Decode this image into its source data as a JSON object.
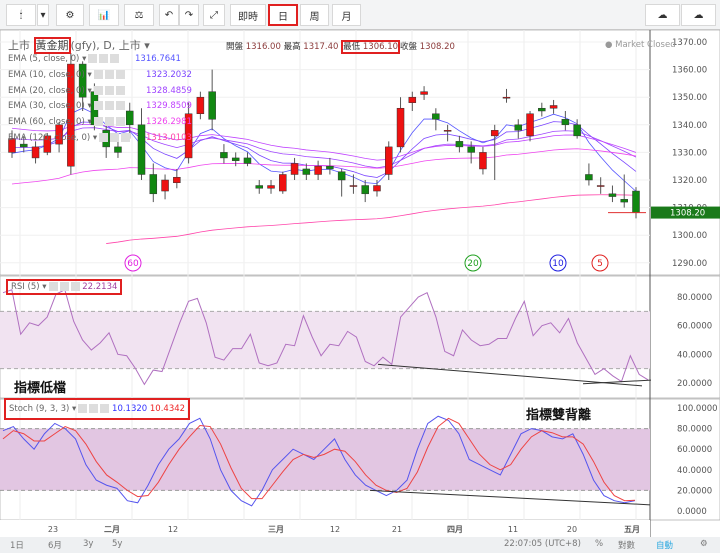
{
  "toolbar": {
    "buttons": [
      "即時",
      "日",
      "周",
      "月"
    ],
    "selected": "日"
  },
  "header": {
    "symbol_prefix": "上市",
    "symbol_name": "黃金期",
    "symbol_rest": "(gfy), D, 上市",
    "open_label": "開盤",
    "open": "1316.00",
    "high_label": "最高",
    "high": "1317.40",
    "low_label": "最低",
    "low": "1306.10",
    "close_label": "收盤",
    "close": "1308.20",
    "market_status": "Market Closed"
  },
  "ema": [
    {
      "label": "EMA (5, close, 0)",
      "value": "1316.7641",
      "color": "#5555ff"
    },
    {
      "label": "EMA (10, close, 0)",
      "value": "1323.2032",
      "color": "#7a44ff"
    },
    {
      "label": "EMA (20, close, 0)",
      "value": "1328.4859",
      "color": "#a044ff"
    },
    {
      "label": "EMA (30, close, 0)",
      "value": "1329.8509",
      "color": "#c044ff"
    },
    {
      "label": "EMA (60, close, 0)",
      "value": "1326.2981",
      "color": "#ee44ee"
    },
    {
      "label": "EMA (120, close, 0)",
      "value": "1313.0103",
      "color": "#ff44aa"
    }
  ],
  "markers": [
    {
      "label": "60",
      "color": "#e020e0"
    },
    {
      "label": "20",
      "color": "#20a020"
    },
    {
      "label": "10",
      "color": "#2020e0"
    },
    {
      "label": "5",
      "color": "#e02020"
    }
  ],
  "price_axis": {
    "ticks": [
      "1370.00",
      "1360.00",
      "1350.00",
      "1340.00",
      "1330.00",
      "1320.00",
      "1310.00",
      "1300.00",
      "1290.00"
    ],
    "last": "1308.20"
  },
  "rsi": {
    "label": "RSI (5)",
    "value": "22.2134",
    "ticks": [
      "80.0000",
      "60.0000",
      "40.0000",
      "20.0000"
    ],
    "annotation": "指標低檔"
  },
  "stoch": {
    "label": "Stoch (9, 3, 3)",
    "k": "10.1320",
    "d": "10.4342",
    "ticks": [
      "100.0000",
      "80.0000",
      "60.0000",
      "40.0000",
      "20.0000",
      "0.0000"
    ],
    "annotation": "指標雙背離"
  },
  "x_axis": [
    "23",
    "二月",
    "12",
    "三月",
    "12",
    "21",
    "四月",
    "11",
    "20",
    "五月"
  ],
  "bottom": {
    "ranges": [
      "1日",
      "6月",
      "3y",
      "5y"
    ],
    "time": "22:07:05 (UTC+8)",
    "percent": "%",
    "log": "對數",
    "auto": "自動"
  },
  "chart_data": {
    "type": "candlestick",
    "ohlc": [
      [
        1330,
        1338,
        1328,
        1335
      ],
      [
        1333,
        1336,
        1330,
        1332
      ],
      [
        1328,
        1334,
        1326,
        1332
      ],
      [
        1330,
        1337,
        1329,
        1336
      ],
      [
        1333,
        1341,
        1330,
        1340
      ],
      [
        1325,
        1366,
        1322,
        1362
      ],
      [
        1362,
        1363,
        1345,
        1350
      ],
      [
        1352,
        1355,
        1338,
        1340
      ],
      [
        1338,
        1342,
        1328,
        1332
      ],
      [
        1332,
        1335,
        1328,
        1330
      ],
      [
        1345,
        1348,
        1335,
        1340
      ],
      [
        1340,
        1346,
        1320,
        1322
      ],
      [
        1322,
        1326,
        1312,
        1315
      ],
      [
        1316,
        1322,
        1313,
        1320
      ],
      [
        1319,
        1324,
        1317,
        1321
      ],
      [
        1328,
        1348,
        1326,
        1344
      ],
      [
        1344,
        1352,
        1342,
        1350
      ],
      [
        1352,
        1360,
        1338,
        1342
      ],
      [
        1330,
        1333,
        1326,
        1328
      ],
      [
        1328,
        1330,
        1325,
        1327
      ],
      [
        1328,
        1330,
        1325,
        1326
      ],
      [
        1318,
        1320,
        1315,
        1317
      ],
      [
        1317,
        1320,
        1315,
        1318
      ],
      [
        1316,
        1323,
        1315,
        1322
      ],
      [
        1322,
        1328,
        1320,
        1326
      ],
      [
        1324,
        1326,
        1320,
        1322
      ],
      [
        1322,
        1327,
        1320,
        1325
      ],
      [
        1325,
        1328,
        1322,
        1324
      ],
      [
        1323,
        1324,
        1314,
        1320
      ],
      [
        1318,
        1322,
        1315,
        1318
      ],
      [
        1318,
        1320,
        1312,
        1315
      ],
      [
        1316,
        1320,
        1314,
        1318
      ],
      [
        1322,
        1334,
        1320,
        1332
      ],
      [
        1332,
        1350,
        1330,
        1346
      ],
      [
        1348,
        1352,
        1345,
        1350
      ],
      [
        1351,
        1354,
        1349,
        1352
      ],
      [
        1344,
        1346,
        1338,
        1342
      ],
      [
        1338,
        1340,
        1334,
        1338
      ],
      [
        1334,
        1336,
        1330,
        1332
      ],
      [
        1332,
        1334,
        1326,
        1330
      ],
      [
        1324,
        1332,
        1322,
        1330
      ],
      [
        1336,
        1340,
        1320,
        1338
      ],
      [
        1350,
        1353,
        1348,
        1350
      ],
      [
        1340,
        1342,
        1335,
        1338
      ],
      [
        1336,
        1345,
        1334,
        1344
      ],
      [
        1346,
        1348,
        1343,
        1345
      ],
      [
        1346,
        1349,
        1344,
        1347
      ],
      [
        1342,
        1345,
        1338,
        1340
      ],
      [
        1340,
        1342,
        1335,
        1336
      ],
      [
        1322,
        1326,
        1318,
        1320
      ],
      [
        1318,
        1321,
        1315,
        1318
      ],
      [
        1315,
        1318,
        1312,
        1314
      ],
      [
        1313,
        1322,
        1310,
        1312
      ],
      [
        1316,
        1317.4,
        1306.1,
        1308.2
      ]
    ],
    "rsi": [
      83,
      85,
      54,
      62,
      60,
      66,
      82,
      85,
      63,
      50,
      43,
      48,
      55,
      40,
      39,
      30,
      19,
      29,
      28,
      45,
      62,
      77,
      79,
      62,
      38,
      36,
      44,
      44,
      54,
      34,
      32,
      34,
      47,
      46,
      67,
      52,
      39,
      47,
      46,
      56,
      52,
      35,
      32,
      38,
      33,
      66,
      73,
      80,
      83,
      66,
      42,
      39,
      57,
      50,
      46,
      47,
      51,
      51,
      65,
      77,
      53,
      60,
      62,
      55,
      65,
      48,
      37,
      26,
      30,
      25,
      21,
      39,
      26,
      22.2
    ],
    "stoch_k": [
      78,
      82,
      70,
      60,
      75,
      85,
      80,
      70,
      45,
      30,
      25,
      22,
      10,
      8,
      25,
      45,
      60,
      70,
      85,
      90,
      70,
      40,
      20,
      10,
      5,
      20,
      40,
      50,
      60,
      55,
      50,
      60,
      70,
      50,
      35,
      25,
      20,
      15,
      20,
      30,
      60,
      85,
      92,
      88,
      75,
      50,
      45,
      40,
      35,
      55,
      75,
      80,
      78,
      72,
      70,
      75,
      55,
      30,
      15,
      10,
      8,
      10.1
    ],
    "stoch_d": [
      70,
      78,
      75,
      68,
      68,
      75,
      82,
      78,
      65,
      48,
      35,
      28,
      20,
      14,
      15,
      28,
      45,
      60,
      72,
      83,
      82,
      65,
      42,
      22,
      12,
      12,
      25,
      38,
      50,
      55,
      52,
      55,
      60,
      58,
      48,
      35,
      25,
      20,
      18,
      22,
      38,
      62,
      82,
      90,
      85,
      70,
      55,
      45,
      40,
      45,
      60,
      72,
      78,
      76,
      72,
      72,
      65,
      48,
      28,
      15,
      10,
      10.4
    ],
    "ylim_price": [
      1285,
      1375
    ],
    "ylim_rsi": [
      10,
      100
    ],
    "ylim_stoch": [
      -5,
      105
    ]
  }
}
